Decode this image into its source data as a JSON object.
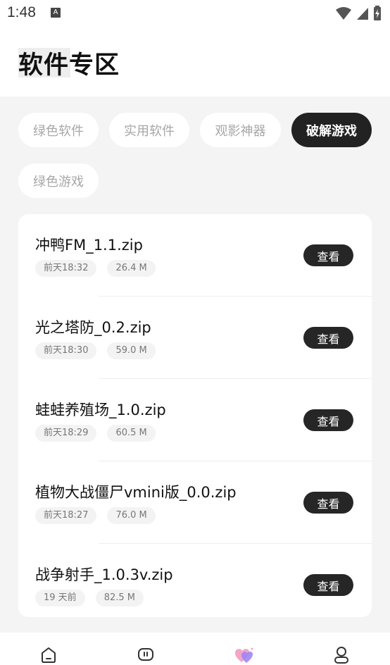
{
  "status": {
    "time": "1:48",
    "notification_badge": "A"
  },
  "header": {
    "title": "软件专区"
  },
  "categories": [
    {
      "label": "绿色软件",
      "active": false
    },
    {
      "label": "实用软件",
      "active": false
    },
    {
      "label": "观影神器",
      "active": false
    },
    {
      "label": "破解游戏",
      "active": true
    },
    {
      "label": "绿色游戏",
      "active": false
    }
  ],
  "files": [
    {
      "name": "冲鸭FM_1.1.zip",
      "time": "前天18:32",
      "size": "26.4 M",
      "action": "查看"
    },
    {
      "name": "光之塔防_0.2.zip",
      "time": "前天18:30",
      "size": "59.0 M",
      "action": "查看"
    },
    {
      "name": "蛙蛙养殖场_1.0.zip",
      "time": "前天18:29",
      "size": "60.5 M",
      "action": "查看"
    },
    {
      "name": "植物大战僵尸vmini版_0.0.zip",
      "time": "前天18:27",
      "size": "76.0 M",
      "action": "查看"
    },
    {
      "name": "战争射手_1.0.3v.zip",
      "time": "19 天前",
      "size": "82.5 M",
      "action": "查看"
    }
  ],
  "tabbar": {
    "icons": [
      "home-icon",
      "chat-icon",
      "heart-icon",
      "profile-icon"
    ],
    "active_index": 2
  },
  "colors": {
    "active_chip": "#222222",
    "button": "#262626",
    "accent_pink": "#f3a6c9",
    "accent_purple": "#9e86f2"
  }
}
